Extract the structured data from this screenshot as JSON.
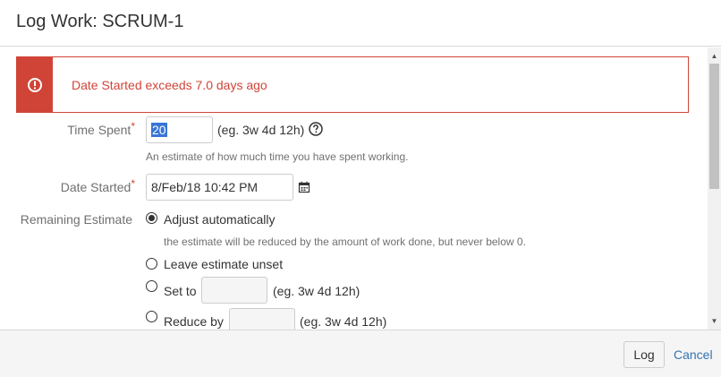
{
  "dialog": {
    "title": "Log Work: SCRUM-1"
  },
  "error": {
    "message": "Date Started exceeds 7.0 days ago",
    "color": "#d04437"
  },
  "fields": {
    "time_spent": {
      "label": "Time Spent",
      "required_mark": "*",
      "value": "20",
      "format_hint": "(eg. 3w 4d 12h)",
      "help_text": "An estimate of how much time you have spent working."
    },
    "date_started": {
      "label": "Date Started",
      "required_mark": "*",
      "value": "8/Feb/18 10:42 PM"
    },
    "remaining_estimate": {
      "label": "Remaining Estimate",
      "options": [
        {
          "label": "Adjust automatically",
          "checked": true,
          "help_text": "the estimate will be reduced by the amount of work done, but never below 0."
        },
        {
          "label": "Leave estimate unset",
          "checked": false
        },
        {
          "label": "Set to",
          "checked": false,
          "format_hint": "(eg. 3w 4d 12h)"
        },
        {
          "label": "Reduce by",
          "checked": false,
          "format_hint": "(eg. 3w 4d 12h)"
        }
      ]
    }
  },
  "footer": {
    "log_label": "Log",
    "cancel_label": "Cancel"
  },
  "colors": {
    "error": "#d04437",
    "link": "#3572b0",
    "selection": "#3875d7"
  }
}
